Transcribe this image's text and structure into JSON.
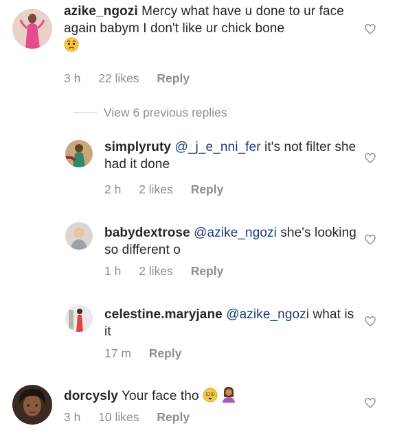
{
  "comments": [
    {
      "username": "azike_ngozi",
      "text": "Mercy what have u done to ur face again babym I don't like ur chick bone",
      "time": "3 h",
      "likes": "22 likes",
      "reply": "Reply",
      "emoji": "worried-face-emoji"
    },
    {
      "username": "simplyruty",
      "mention": "@_j_e_nni_fer",
      "text": "it's not filter she had it done",
      "time": "2 h",
      "likes": "2 likes",
      "reply": "Reply"
    },
    {
      "username": "babydextrose",
      "mention": "@azike_ngozi",
      "text": "she's looking so different o",
      "time": "1 h",
      "likes": "2 likes",
      "reply": "Reply"
    },
    {
      "username": "celestine.maryjane",
      "mention": "@azike_ngozi",
      "text": "what is it",
      "time": "17 m",
      "likes": "",
      "reply": "Reply"
    },
    {
      "username": "dorcysly",
      "text": "Your face tho",
      "time": "3 h",
      "likes": "10 likes",
      "reply": "Reply",
      "emoji": "flushed-face-emoji, person-tipping-hand-emoji"
    }
  ],
  "view_replies": "View 6 previous replies",
  "icons": {
    "like": "heart-outline-icon"
  },
  "colors": {
    "text": "#262626",
    "muted": "#8e8e8e",
    "mention": "#1a3a78"
  }
}
